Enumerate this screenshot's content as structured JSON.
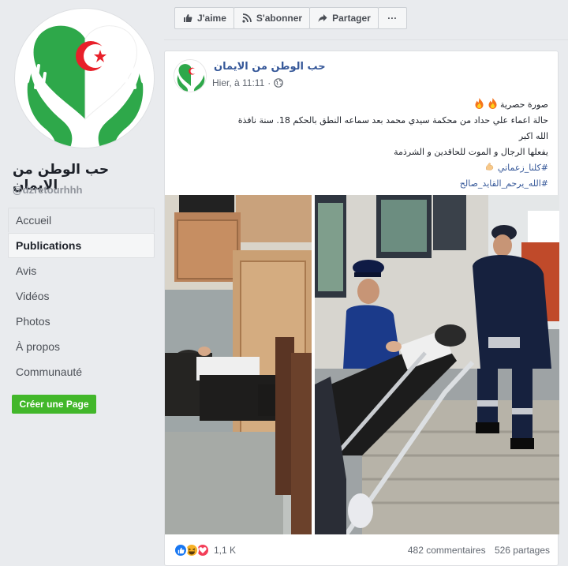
{
  "page": {
    "name": "حب الوطن من الايمان",
    "handle": "@dzretourhhh"
  },
  "nav": {
    "items": [
      {
        "label": "Accueil",
        "active": false
      },
      {
        "label": "Publications",
        "active": true
      },
      {
        "label": "Avis",
        "active": false
      },
      {
        "label": "Vidéos",
        "active": false
      },
      {
        "label": "Photos",
        "active": false
      },
      {
        "label": "À propos",
        "active": false
      },
      {
        "label": "Communauté",
        "active": false
      }
    ],
    "create_page_label": "Créer une Page"
  },
  "actions": {
    "like_label": "J'aime",
    "subscribe_label": "S'abonner",
    "share_label": "Partager",
    "more_label": "···"
  },
  "post": {
    "author": "حب الوطن من الايمان",
    "time": "Hier, à 11:11",
    "lines": {
      "l1": "صورة حصرية",
      "l2": "حالة اعماء علي حداد من محكمة سيدي محمد بعد سماعه النطق بالحكم 18. سنة نافذة",
      "l3": "الله اكبر",
      "l4": "يفعلها الرجال و الموت للحاقدين و الشرذمة",
      "l5": "#كلنا_زعماتي",
      "l6": "#الله_يرحم_القايد_صالح"
    },
    "reaction_count": "1,1 K",
    "comments": "482 commentaires",
    "shares": "526 partages"
  },
  "colors": {
    "brand_green": "#42b72a",
    "link_blue": "#365899",
    "flag_green": "#2ea84a",
    "flag_red": "#e8202a"
  },
  "icons": {
    "like": "thumbs-up-icon",
    "subscribe": "rss-icon",
    "share": "share-arrow-icon",
    "audience": "globe-icon"
  }
}
